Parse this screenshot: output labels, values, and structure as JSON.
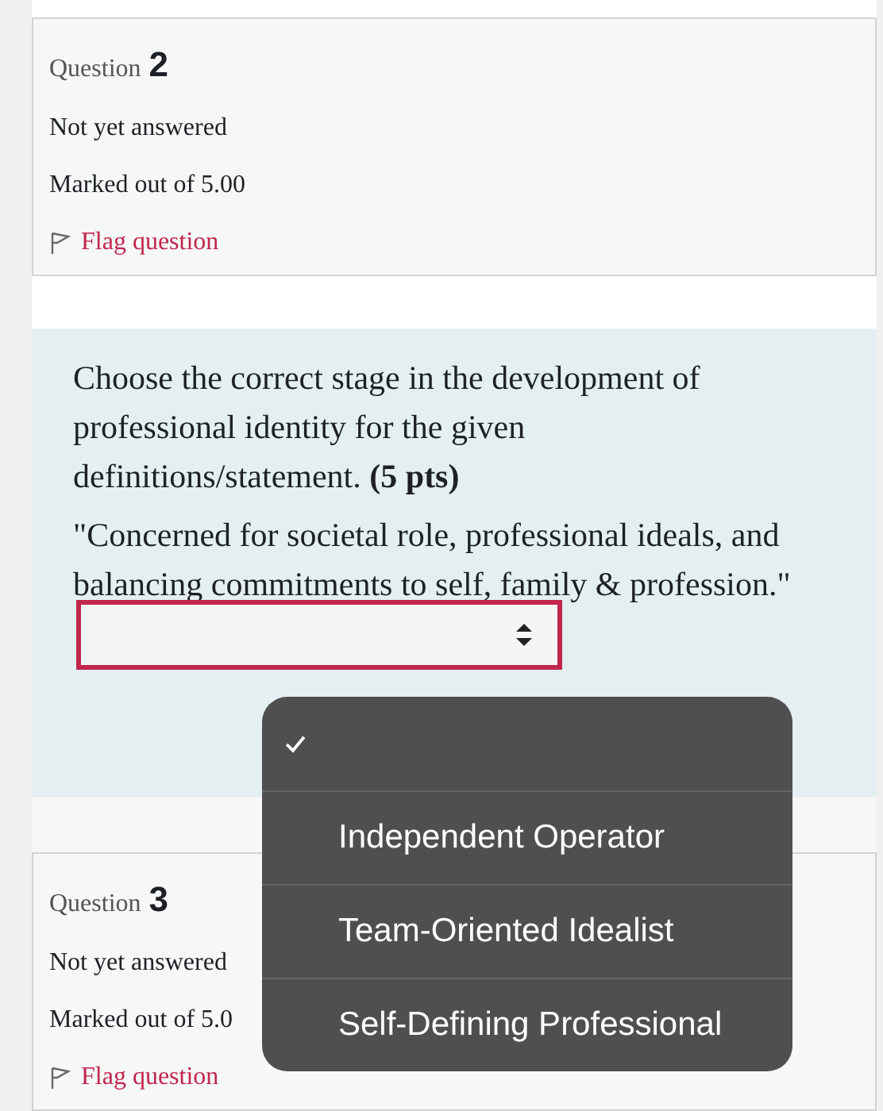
{
  "questions_before": {
    "label": "Question",
    "number": "2",
    "status": "Not yet answered",
    "marks": "Marked out of 5.00",
    "flag": "Flag question"
  },
  "question_text": {
    "prompt": "Choose the correct stage in the development of professional identity for the given definitions/statement. **(5 pts)**",
    "statement": "\"Concerned for societal role, professional ideals, and balancing commitments to self, family & profession.\""
  },
  "dropdown_menu": {
    "options": [
      {
        "selected": true
      },
      {
        "label": "Independent Operator",
        "selected": false
      },
      {
        "label": "Team-Oriented Idealist",
        "selected": false
      },
      {
        "label": "Self-Defining Professional",
        "selected": false
      }
    ]
  },
  "question_after": {
    "label": "Question",
    "number": "3",
    "status": "Not yet answered",
    "marks": "Marked out of 5.0",
    "flag": "Flag question"
  }
}
